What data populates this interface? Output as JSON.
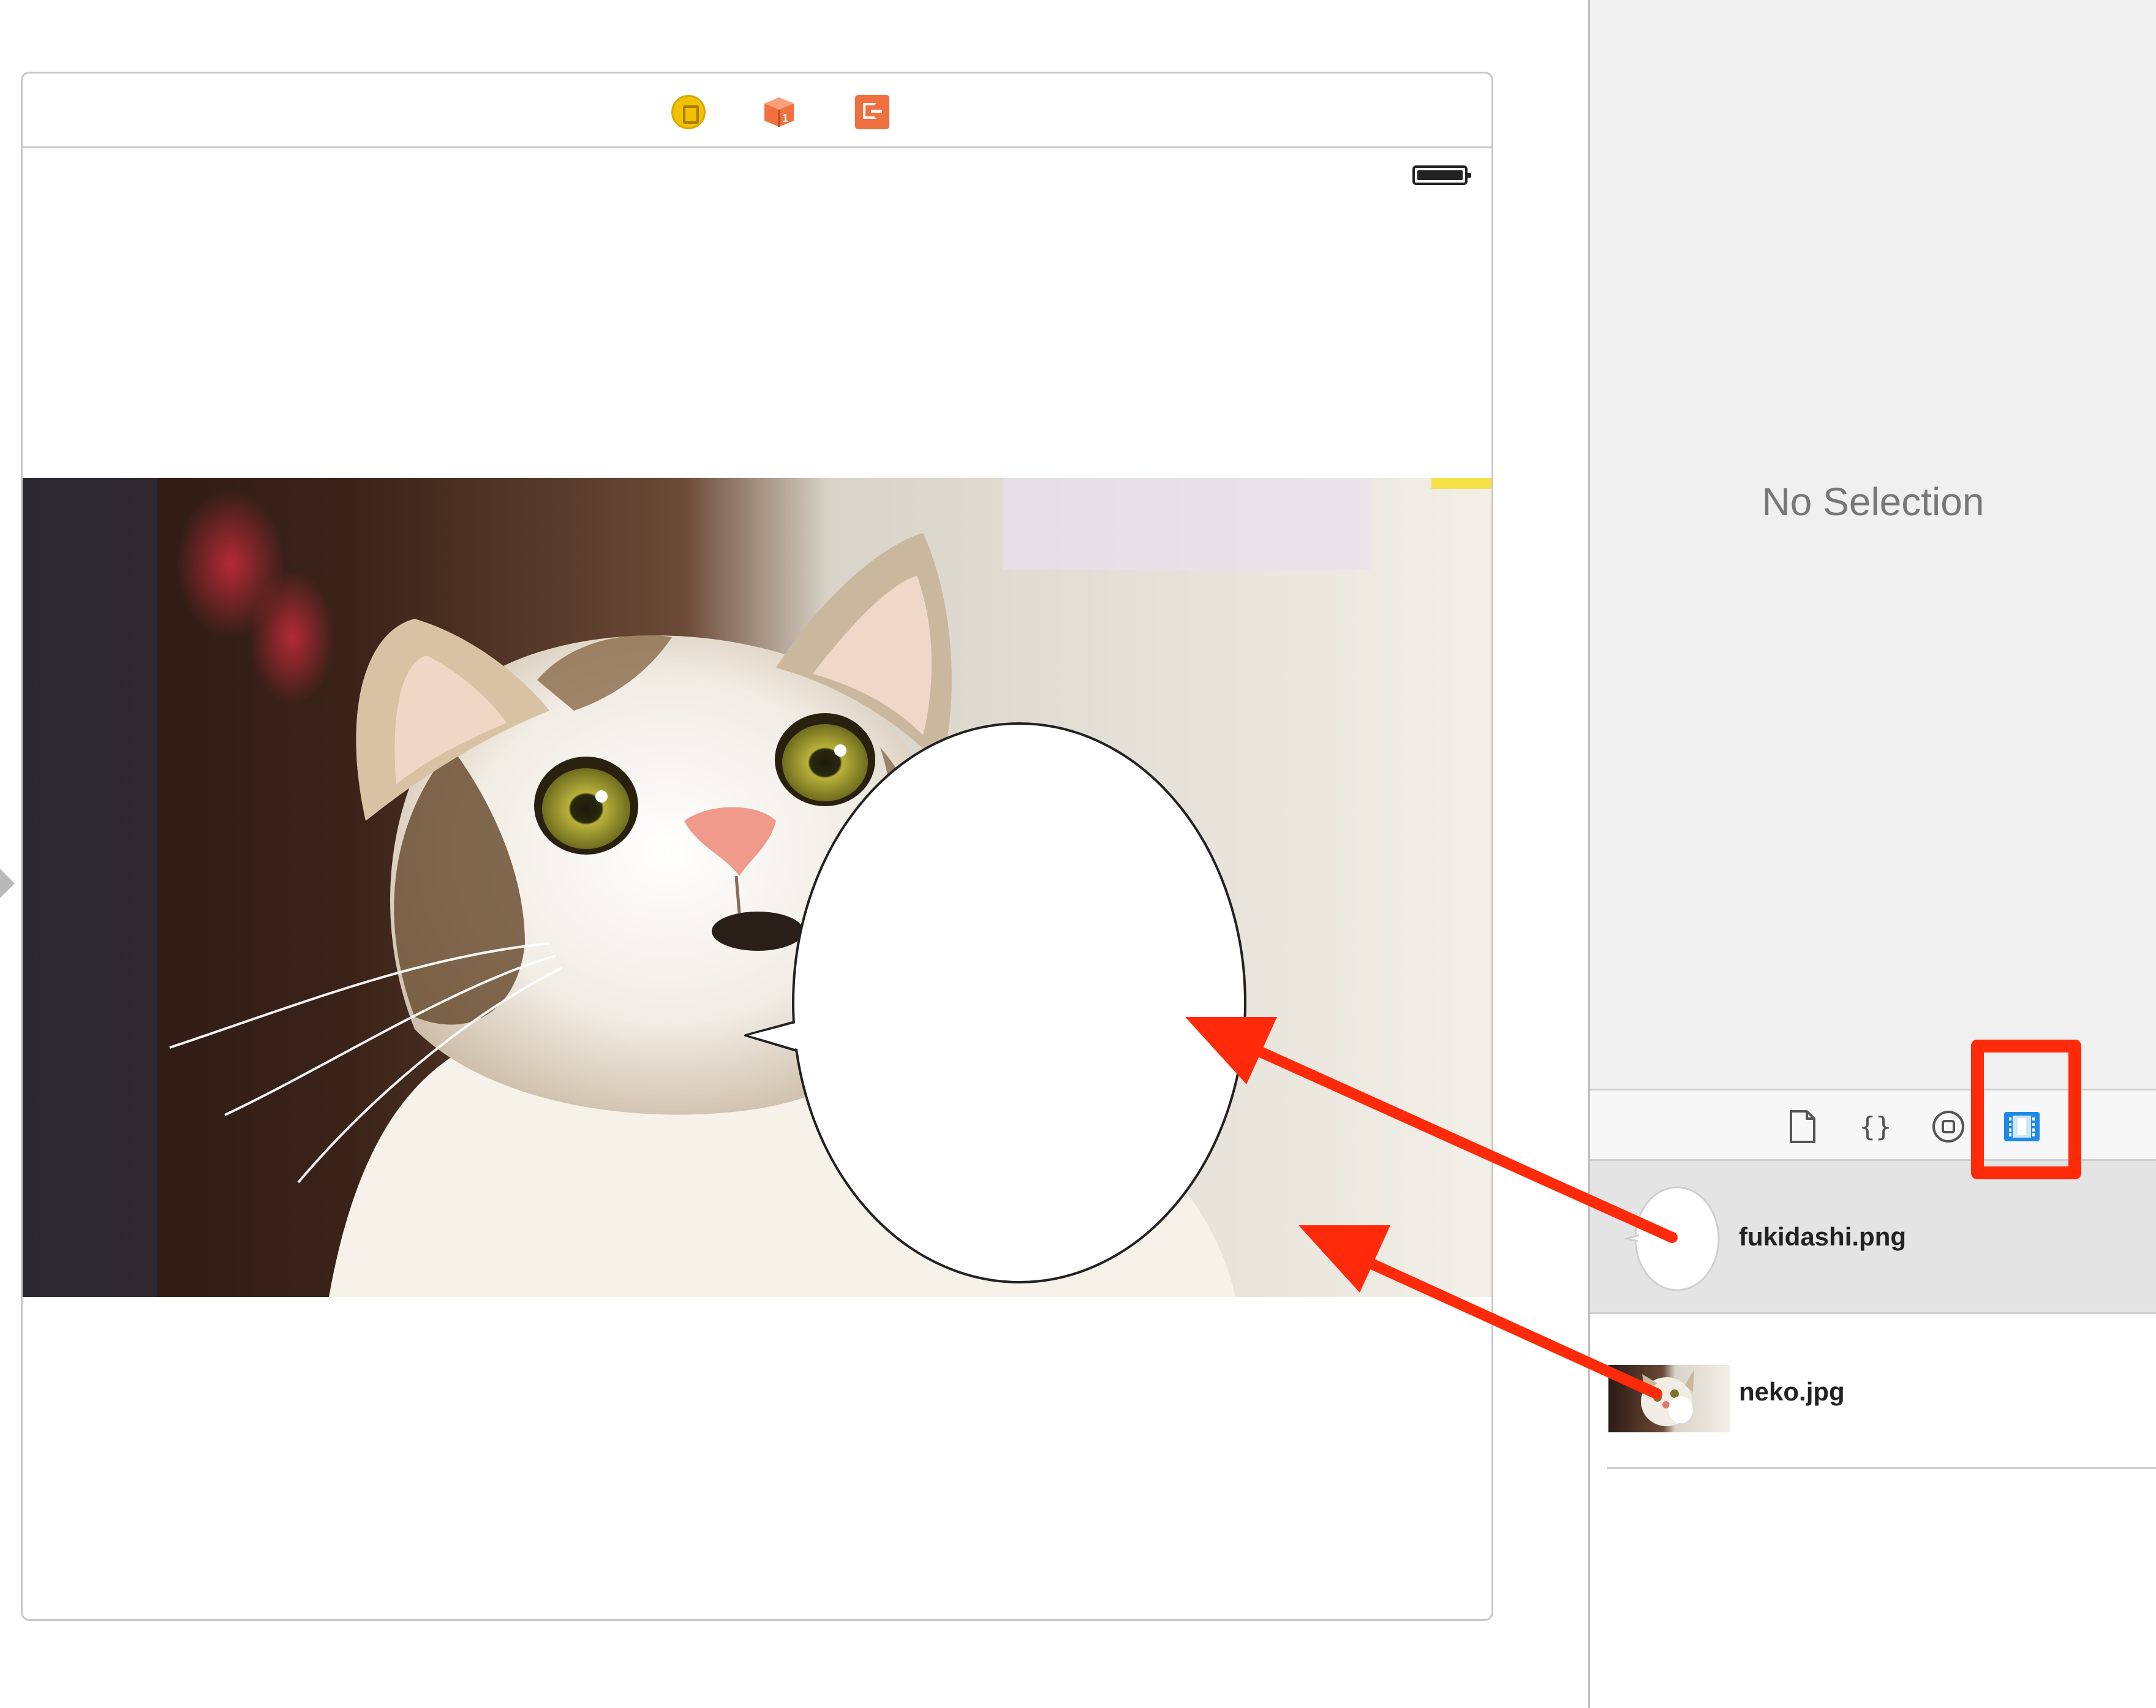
{
  "inspector": {
    "empty_text": "No Selection"
  },
  "library_tabs": [
    {
      "icon": "file-template-icon",
      "label": ""
    },
    {
      "icon": "code-snippet-icon",
      "label": "{}"
    },
    {
      "icon": "object-library-icon",
      "label": ""
    },
    {
      "icon": "media-library-icon",
      "label": ""
    }
  ],
  "library_items": [
    {
      "name": "fukidashi.png",
      "icon": "speech-bubble-thumbnail"
    },
    {
      "name": "neko.jpg",
      "icon": "cat-photo-thumbnail"
    }
  ],
  "annotation": {
    "color": "#ff2a0a"
  },
  "scene_dock": [
    {
      "icon": "view-controller-icon"
    },
    {
      "icon": "first-responder-icon"
    },
    {
      "icon": "exit-icon"
    }
  ]
}
